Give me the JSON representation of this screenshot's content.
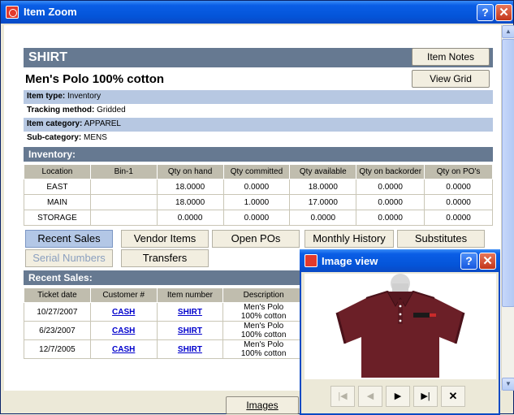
{
  "window": {
    "title": "Item Zoom"
  },
  "item": {
    "code": "SHIRT",
    "description": "Men's Polo 100% cotton",
    "notes_label": "Item Notes",
    "grid_label": "View Grid",
    "type_label": "Item type:",
    "type_value": "Inventory",
    "tracking_label": "Tracking method:",
    "tracking_value": "Gridded",
    "category_label": "Item category:",
    "category_value": "APPAREL",
    "subcategory_label": "Sub-category:",
    "subcategory_value": "MENS"
  },
  "inventory": {
    "title": "Inventory:",
    "columns": [
      "Location",
      "Bin-1",
      "Qty on hand",
      "Qty committed",
      "Qty available",
      "Qty on backorder",
      "Qty on PO's"
    ],
    "rows": [
      [
        "EAST",
        "",
        "18.0000",
        "0.0000",
        "18.0000",
        "0.0000",
        "0.0000"
      ],
      [
        "MAIN",
        "",
        "18.0000",
        "1.0000",
        "17.0000",
        "0.0000",
        "0.0000"
      ],
      [
        "STORAGE",
        "",
        "0.0000",
        "0.0000",
        "0.0000",
        "0.0000",
        "0.0000"
      ]
    ]
  },
  "tabs": [
    {
      "label": "Recent Sales",
      "state": "active"
    },
    {
      "label": "Vendor Items",
      "state": "normal"
    },
    {
      "label": "Open POs",
      "state": "normal"
    },
    {
      "label": "Monthly History",
      "state": "normal"
    },
    {
      "label": "Substitutes",
      "state": "normal"
    },
    {
      "label": "Serial Numbers",
      "state": "disabled"
    },
    {
      "label": "Transfers",
      "state": "normal"
    }
  ],
  "recent_sales": {
    "title": "Recent Sales:",
    "columns": [
      "Ticket date",
      "Customer #",
      "Item number",
      "Description"
    ],
    "rows": [
      [
        "10/27/2007",
        "CASH",
        "SHIRT",
        "Men's Polo\n100% cotton"
      ],
      [
        "6/23/2007",
        "CASH",
        "SHIRT",
        "Men's Polo\n100% cotton"
      ],
      [
        "12/7/2005",
        "CASH",
        "SHIRT",
        "Men's Polo\n100% cotton"
      ]
    ]
  },
  "footer": {
    "images_label": "Images"
  },
  "image_view": {
    "title": "Image view",
    "nav": [
      "first",
      "prev",
      "next",
      "last",
      "close"
    ]
  },
  "colors": {
    "title_blue": "#0454d8",
    "header_slate": "#667991",
    "row_alt": "#b7c8e2",
    "shirt": "#6b1f27"
  }
}
